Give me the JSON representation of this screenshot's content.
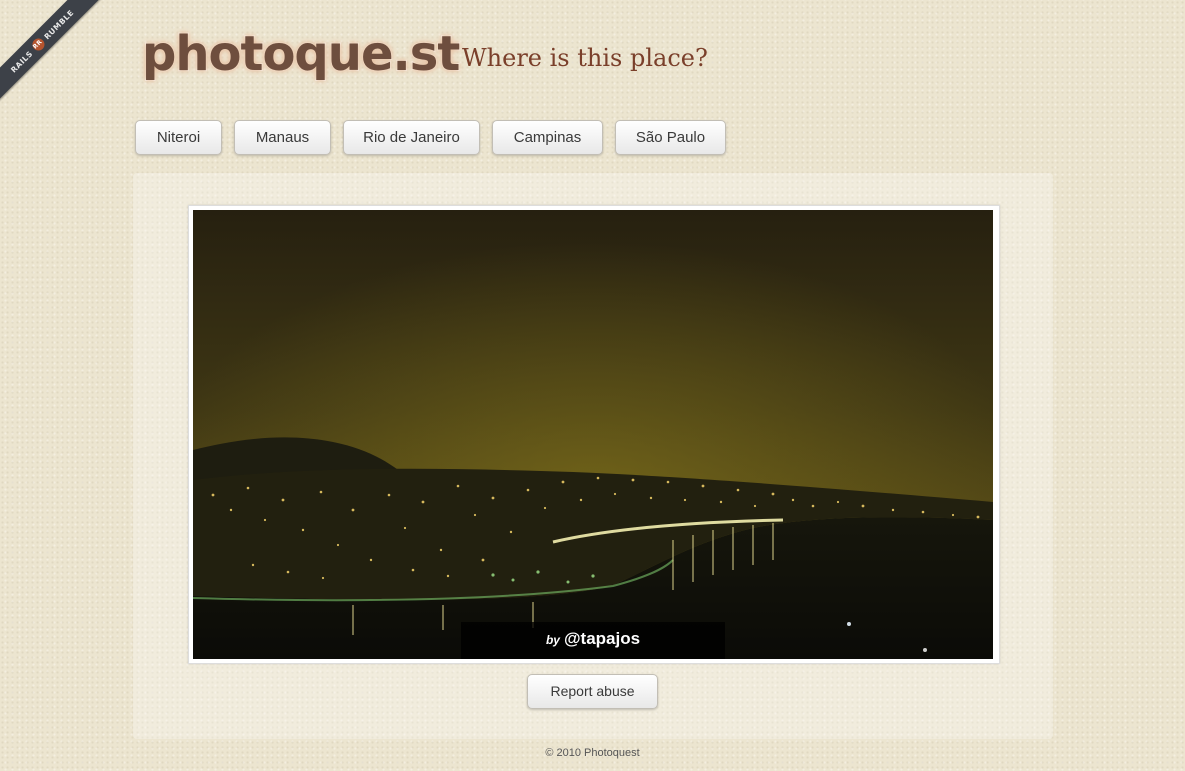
{
  "ribbon": {
    "left_text": "RAILS",
    "badge": "RR",
    "right_text": "RUMBLE"
  },
  "header": {
    "logo_text": "photoque.st",
    "tagline": "Where is this place?"
  },
  "choices": [
    {
      "label": "Niteroi"
    },
    {
      "label": "Manaus"
    },
    {
      "label": "Rio de Janeiro"
    },
    {
      "label": "Campinas"
    },
    {
      "label": "São Paulo"
    }
  ],
  "photo": {
    "credit_prefix": "by",
    "credit_handle": "@tapajos"
  },
  "report_label": "Report abuse",
  "footer": "© 2010 Photoquest"
}
